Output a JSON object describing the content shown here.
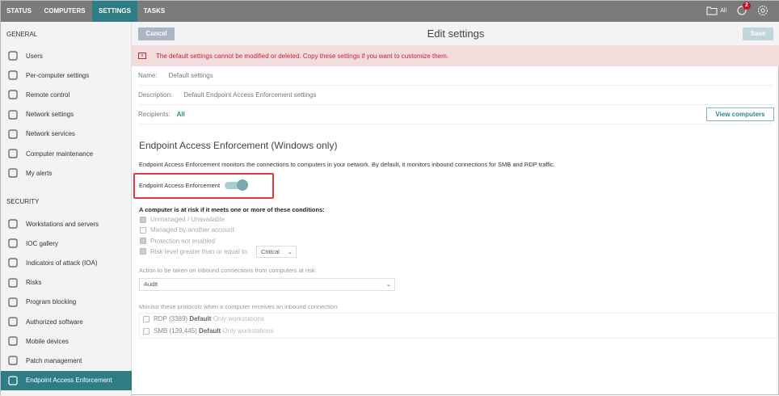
{
  "topnav": {
    "tabs": [
      "STATUS",
      "COMPUTERS",
      "SETTINGS",
      "TASKS"
    ],
    "active": "SETTINGS",
    "folder_label": "All",
    "notifications_count": "2"
  },
  "sidebar": {
    "general_heading": "GENERAL",
    "general": [
      {
        "label": "Users",
        "icon": "users-icon"
      },
      {
        "label": "Per-computer settings",
        "icon": "per-computer-icon"
      },
      {
        "label": "Remote control",
        "icon": "monitor-icon"
      },
      {
        "label": "Network settings",
        "icon": "globe-icon"
      },
      {
        "label": "Network services",
        "icon": "server-icon"
      },
      {
        "label": "Computer maintenance",
        "icon": "maintenance-icon"
      },
      {
        "label": "My alerts",
        "icon": "warning-icon"
      }
    ],
    "security_heading": "SECURITY",
    "security": [
      {
        "label": "Workstations and servers",
        "icon": "workstation-icon"
      },
      {
        "label": "IOC gallery",
        "icon": "ioc-search-icon"
      },
      {
        "label": "Indicators of attack (IOA)",
        "icon": "ioa-icon"
      },
      {
        "label": "Risks",
        "icon": "risk-icon"
      },
      {
        "label": "Program blocking",
        "icon": "window-icon"
      },
      {
        "label": "Authorized software",
        "icon": "check-circle-icon"
      },
      {
        "label": "Mobile devices",
        "icon": "mobile-icon"
      },
      {
        "label": "Patch management",
        "icon": "patch-icon"
      },
      {
        "label": "Endpoint Access Enforcement",
        "icon": "network-tree-icon"
      }
    ]
  },
  "header": {
    "cancel": "Cancel",
    "title": "Edit settings",
    "save": "Save"
  },
  "banner": "The default settings cannot be modified or deleted. Copy these settings if you want to customize them.",
  "fields": {
    "name_label": "Name:",
    "name_value": "Default settings",
    "desc_label": "Description:",
    "desc_value": "Default Endpoint Access Enforcement settings",
    "recipients_label": "Recipients:",
    "recipients_value": "All",
    "view_computers": "View computers"
  },
  "section": {
    "title": "Endpoint Access Enforcement (Windows only)",
    "description": "Endpoint Access Enforcement monitors the connections to computers in your network. By default, it monitors inbound connections for SMB and RDP traffic.",
    "toggle_label": "Endpoint Access Enforcement",
    "toggle_on": true,
    "conditions_heading": "A computer is at risk if it meets one or more of these conditions:",
    "conditions": [
      {
        "label": "Unmanaged / Unavailable",
        "checked": true
      },
      {
        "label": "Managed by another account",
        "checked": false
      },
      {
        "label": "Protection not enabled",
        "checked": true
      },
      {
        "label": "Risk level greater than or equal to:",
        "checked": true
      }
    ],
    "risk_level": "Critical",
    "action_label": "Action to be taken on inbound connections from computers at risk:",
    "action_value": "Audit",
    "protocols_label": "Monitor these protocols when a computer receives an inbound connection:",
    "protocols": [
      {
        "name": "RDP (3389)",
        "tag": "Default",
        "note": "Only workstations"
      },
      {
        "name": "SMB (139,445)",
        "tag": "Default",
        "note": "Only workstations"
      }
    ]
  }
}
